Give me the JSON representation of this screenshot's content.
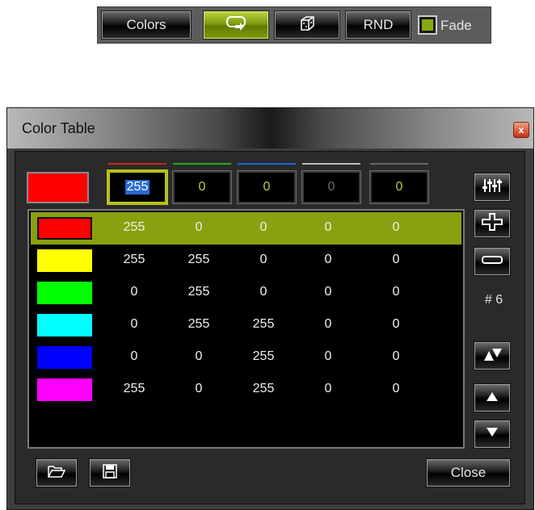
{
  "toolbar": {
    "colors_label": "Colors",
    "loop_icon": "loop-arrow-icon",
    "dice_icon": "dice-icon",
    "rnd_label": "RND",
    "fade_label": "Fade",
    "fade_checked": true
  },
  "dialog": {
    "title": "Color Table",
    "close_icon": "close-x-icon",
    "current": {
      "swatch": "#ff0000",
      "fields": [
        {
          "channel": "red",
          "color": "#cc2222",
          "value": "255",
          "selected": true
        },
        {
          "channel": "green",
          "color": "#22aa22",
          "value": "0"
        },
        {
          "channel": "blue",
          "color": "#2266dd",
          "value": "0"
        },
        {
          "channel": "white",
          "color": "#bbbbbb",
          "value": "0",
          "dimmed": true
        },
        {
          "channel": "alpha",
          "color": "#666666",
          "value": "0"
        }
      ]
    },
    "rows": [
      {
        "swatch": "#ff0000",
        "values": [
          "255",
          "0",
          "0",
          "0",
          "0"
        ],
        "selected": true
      },
      {
        "swatch": "#ffff00",
        "values": [
          "255",
          "255",
          "0",
          "0",
          "0"
        ]
      },
      {
        "swatch": "#00ff00",
        "values": [
          "0",
          "255",
          "0",
          "0",
          "0"
        ]
      },
      {
        "swatch": "#00ffff",
        "values": [
          "0",
          "255",
          "255",
          "0",
          "0"
        ]
      },
      {
        "swatch": "#0000ff",
        "values": [
          "0",
          "0",
          "255",
          "0",
          "0"
        ]
      },
      {
        "swatch": "#ff00ff",
        "values": [
          "255",
          "0",
          "255",
          "0",
          "0"
        ]
      }
    ],
    "side": {
      "mixer_icon": "sliders-icon",
      "add_icon": "plus-icon",
      "remove_icon": "minus-icon",
      "count": "# 6",
      "sort_icon": "sort-up-down-icon",
      "up_icon": "arrow-up-icon",
      "down_icon": "arrow-down-icon"
    },
    "footer": {
      "open_icon": "folder-open-icon",
      "save_icon": "floppy-save-icon",
      "close_label": "Close"
    }
  }
}
